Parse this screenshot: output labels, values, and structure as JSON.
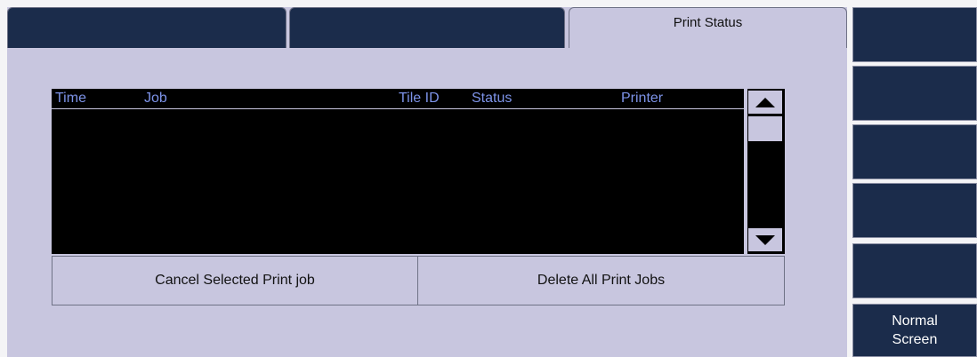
{
  "tabs": [
    {
      "label": ""
    },
    {
      "label": ""
    },
    {
      "label": "Print Status"
    }
  ],
  "table": {
    "columns": [
      "Time",
      "Job",
      "Tile ID",
      "Status",
      "Printer"
    ],
    "rows": []
  },
  "actions": {
    "cancel_label": "Cancel Selected Print job",
    "delete_all_label": "Delete All Print Jobs"
  },
  "side_buttons": [
    {
      "line1": "",
      "line2": ""
    },
    {
      "line1": "",
      "line2": ""
    },
    {
      "line1": "",
      "line2": ""
    },
    {
      "line1": "",
      "line2": ""
    },
    {
      "line1": "",
      "line2": ""
    },
    {
      "line1": "Normal",
      "line2": "Screen"
    }
  ],
  "colors": {
    "panel_bg": "#c8c6df",
    "dark_button": "#1b2c4b",
    "table_bg": "#000000",
    "header_text": "#7d93e8"
  },
  "icons": [
    "arrow-up-icon",
    "arrow-down-icon"
  ]
}
